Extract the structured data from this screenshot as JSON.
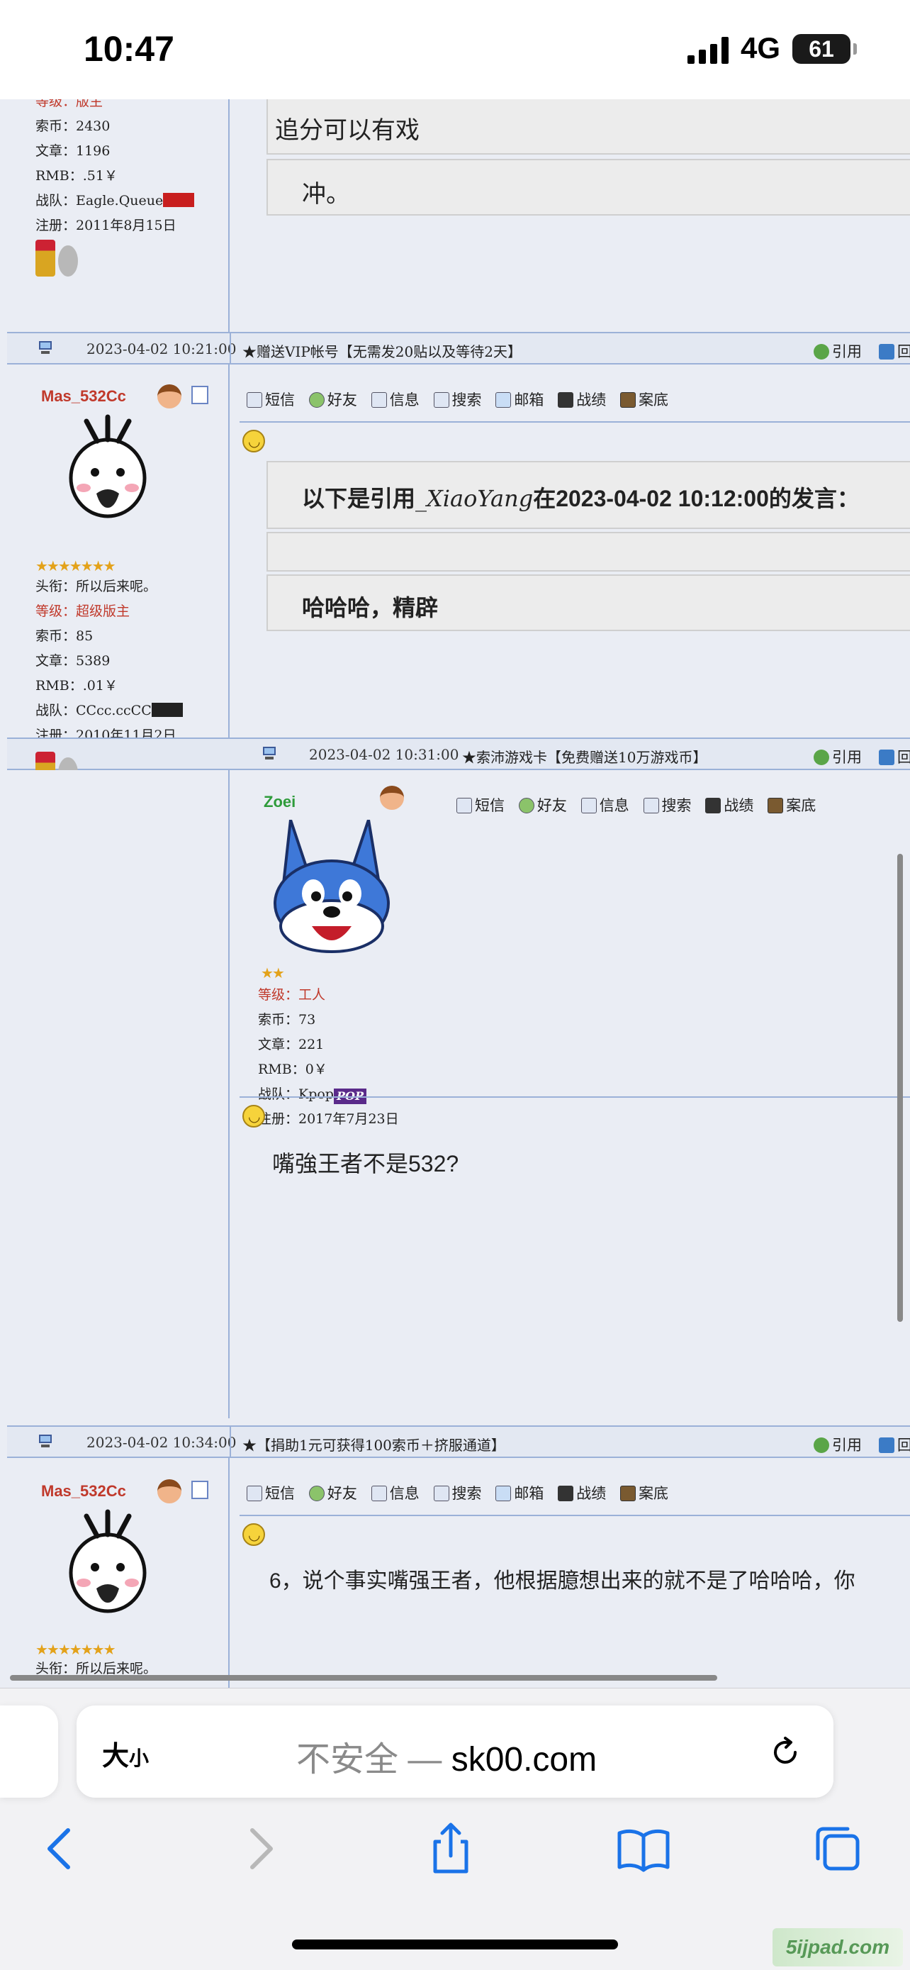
{
  "status_bar": {
    "time": "10:47",
    "network": "4G",
    "battery": "61"
  },
  "post1": {
    "user_lines": {
      "level_label": "等级：",
      "level_value": "版主",
      "coins": "索币：2430",
      "articles": "文章：1196",
      "rmb": "RMB：.51￥",
      "team": "战队：Eagle.Queue",
      "joined": "注册：2011年8月15日"
    },
    "quote_line": "追分可以有戏",
    "reply_line": "冲。"
  },
  "post2": {
    "bar": {
      "date": "2023-04-02 10:21:00",
      "title": "★赠送VIP帐号【无需发20贴以及等待2天】",
      "cite": "引用",
      "reply": "回复"
    },
    "username": "Mas_532Cc",
    "stars": "★★★★★★★",
    "user_lines": {
      "title": "头衔：所以后来呢。",
      "level_label": "等级：",
      "level_value": "超级版主",
      "coins": "索币：85",
      "articles": "文章：5389",
      "rmb": "RMB：.01￥",
      "team": "战队：CCcc.ccCC",
      "joined": "注册：2010年11月2日"
    },
    "toolbar": [
      "短信",
      "好友",
      "信息",
      "搜索",
      "邮箱",
      "战绩",
      "案底"
    ],
    "quote_header_pre": "以下是引用",
    "quote_header_user": "_XiaoYang",
    "quote_header_post": "在2023-04-02 10:12:00的发言：",
    "reply_text": "哈哈哈，精辟"
  },
  "post3": {
    "bar": {
      "date": "2023-04-02 10:31:00",
      "title": "★索沛游戏卡【免费赠送10万游戏币】",
      "cite": "引用",
      "reply": "回复"
    },
    "username": "Zoei",
    "stars": "★★",
    "user_lines": {
      "level_label": "等级：",
      "level_value": "工人",
      "coins": "索币：73",
      "articles": "文章：221",
      "rmb": "RMB：0￥",
      "team": "战队：Kpop",
      "team_badge": "POP",
      "joined": "注册：2017年7月23日"
    },
    "toolbar": [
      "短信",
      "好友",
      "信息",
      "搜索",
      "战绩",
      "案底"
    ],
    "body": "嘴強王者不是532?"
  },
  "post4": {
    "bar": {
      "date": "2023-04-02 10:34:00",
      "title": "★【捐助1元可获得100索币＋挤服通道】",
      "cite": "引用",
      "reply": "回复"
    },
    "username": "Mas_532Cc",
    "stars": "★★★★★★★",
    "title_line": "头衔：所以后来呢。",
    "toolbar": [
      "短信",
      "好友",
      "信息",
      "搜索",
      "邮箱",
      "战绩",
      "案底"
    ],
    "body": "6，说个事实嘴强王者，他根据臆想出来的就不是了哈哈哈，你"
  },
  "browser": {
    "text_size_big": "大",
    "text_size_small": "小",
    "url_prefix": "不安全 — ",
    "url_domain": "sk00.com",
    "watermark": "5ijpad.com"
  }
}
